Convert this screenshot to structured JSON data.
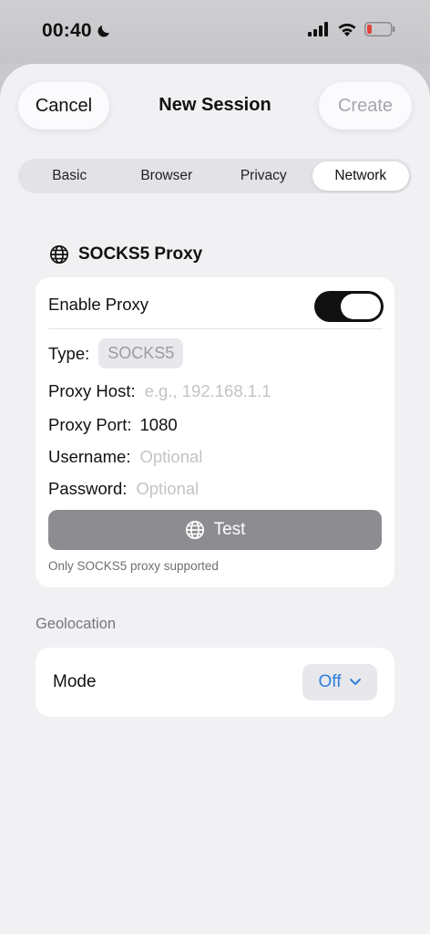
{
  "status_bar": {
    "time": "00:40",
    "focus_icon": "moon-icon",
    "battery_color": "#e0443e"
  },
  "header": {
    "cancel_label": "Cancel",
    "title": "New Session",
    "create_label": "Create"
  },
  "tabs": [
    {
      "label": "Basic",
      "active": false
    },
    {
      "label": "Browser",
      "active": false
    },
    {
      "label": "Privacy",
      "active": false
    },
    {
      "label": "Network",
      "active": true
    }
  ],
  "proxy": {
    "section_title": "SOCKS5 Proxy",
    "section_icon": "globe-icon",
    "enable_label": "Enable Proxy",
    "enabled": true,
    "type_label": "Type:",
    "type_value": "SOCKS5",
    "host_label": "Proxy Host:",
    "host_placeholder": "e.g., 192.168.1.1",
    "host_value": "",
    "port_label": "Proxy Port:",
    "port_value": "1080",
    "username_label": "Username:",
    "username_placeholder": "Optional",
    "password_label": "Password:",
    "password_placeholder": "Optional",
    "test_label": "Test",
    "hint": "Only SOCKS5 proxy supported"
  },
  "geolocation": {
    "section_label": "Geolocation",
    "mode_label": "Mode",
    "mode_value": "Off",
    "accent": "#2f80d9"
  }
}
